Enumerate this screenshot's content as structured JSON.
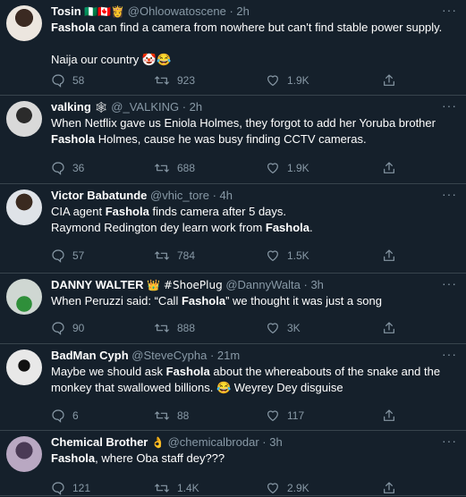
{
  "tweets": [
    {
      "name": "Tosin",
      "name_emoji": "🇳🇬🇨🇦👸",
      "handle": "@Ohloowatoscene",
      "time": "2h",
      "text_html": "<b>Fashola</b> can find a camera from nowhere but can't find stable power supply.\n\nNaija our country 🤡😂",
      "replies": "58",
      "retweets": "923",
      "likes": "1.9K"
    },
    {
      "name": "valking",
      "name_emoji": "🕸",
      "handle": "@_VALKING",
      "time": "2h",
      "text_html": "When Netflix gave us Eniola Holmes, they forgot to add her Yoruba brother <b>Fashola</b> Holmes, cause he was busy finding CCTV cameras.",
      "replies": "36",
      "retweets": "688",
      "likes": "1.9K"
    },
    {
      "name": "Victor Babatunde",
      "name_emoji": "",
      "handle": "@vhic_tore",
      "time": "4h",
      "text_html": "CIA agent <b>Fashola</b> finds camera after 5 days.\nRaymond Redington dey learn work from <b>Fashola</b>.",
      "replies": "57",
      "retweets": "784",
      "likes": "1.5K"
    },
    {
      "name": "DANNY WALTER",
      "name_emoji": "👑 #ShoePlug",
      "handle": "@DannyWalta",
      "time": "3h",
      "text_html": "When Peruzzi said: “Call <b>Fashola</b>” we thought it was just a song",
      "replies": "90",
      "retweets": "888",
      "likes": "3K"
    },
    {
      "name": "BadMan Cyph",
      "name_emoji": "",
      "handle": "@SteveCypha",
      "time": "21m",
      "text_html": "Maybe we should ask <b>Fashola</b> about the whereabouts of the snake and the monkey that swallowed billions. 😂 Weyrey Dey disguise",
      "replies": "6",
      "retweets": "88",
      "likes": "117"
    },
    {
      "name": "Chemical Brother",
      "name_emoji": "👌",
      "handle": "@chemicalbrodar",
      "time": "3h",
      "text_html": "<b>Fashola</b>, where Oba staff dey???",
      "replies": "121",
      "retweets": "1.4K",
      "likes": "2.9K"
    }
  ],
  "icons": {
    "reply": "reply-icon",
    "retweet": "retweet-icon",
    "like": "like-icon",
    "share": "share-icon",
    "more": "more-icon"
  },
  "colors": {
    "background": "#15202b",
    "secondary_text": "#8899a6",
    "divider": "#38444d"
  }
}
